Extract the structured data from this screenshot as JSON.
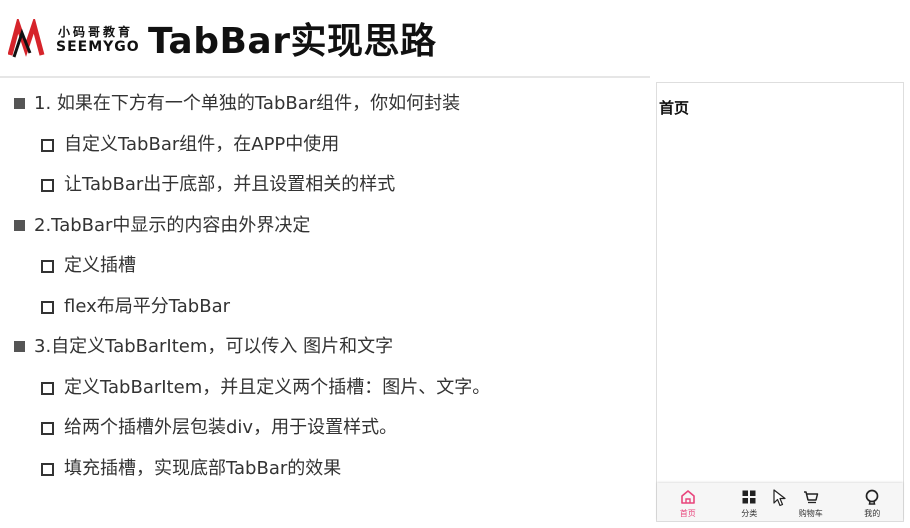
{
  "header": {
    "logo_cn": "小码哥教育",
    "logo_en": "SEEMYGO",
    "title": "TabBar实现思路"
  },
  "bullets": [
    {
      "level": 1,
      "text": "1. 如果在下方有一个单独的TabBar组件，你如何封装"
    },
    {
      "level": 2,
      "text": "自定义TabBar组件，在APP中使用"
    },
    {
      "level": 2,
      "text": "让TabBar出于底部，并且设置相关的样式"
    },
    {
      "level": 1,
      "text": "2.TabBar中显示的内容由外界决定"
    },
    {
      "level": 2,
      "text": "定义插槽"
    },
    {
      "level": 2,
      "text": "flex布局平分TabBar"
    },
    {
      "level": 1,
      "text": "3.自定义TabBarItem，可以传入 图片和文字"
    },
    {
      "level": 2,
      "text": "定义TabBarItem，并且定义两个插槽：图片、文字。"
    },
    {
      "level": 2,
      "text": "给两个插槽外层包装div，用于设置样式。"
    },
    {
      "level": 2,
      "text": "填充插槽，实现底部TabBar的效果"
    }
  ],
  "phone": {
    "content_title": "首页",
    "tabs": [
      {
        "label": "首页",
        "icon": "home-icon",
        "active": true
      },
      {
        "label": "分类",
        "icon": "grid-icon",
        "active": false
      },
      {
        "label": "购物车",
        "icon": "cart-icon",
        "active": false
      },
      {
        "label": "我的",
        "icon": "profile-icon",
        "active": false
      }
    ]
  },
  "colors": {
    "accent": "#e8457c",
    "logo_red": "#d6242b",
    "text": "#333333"
  }
}
